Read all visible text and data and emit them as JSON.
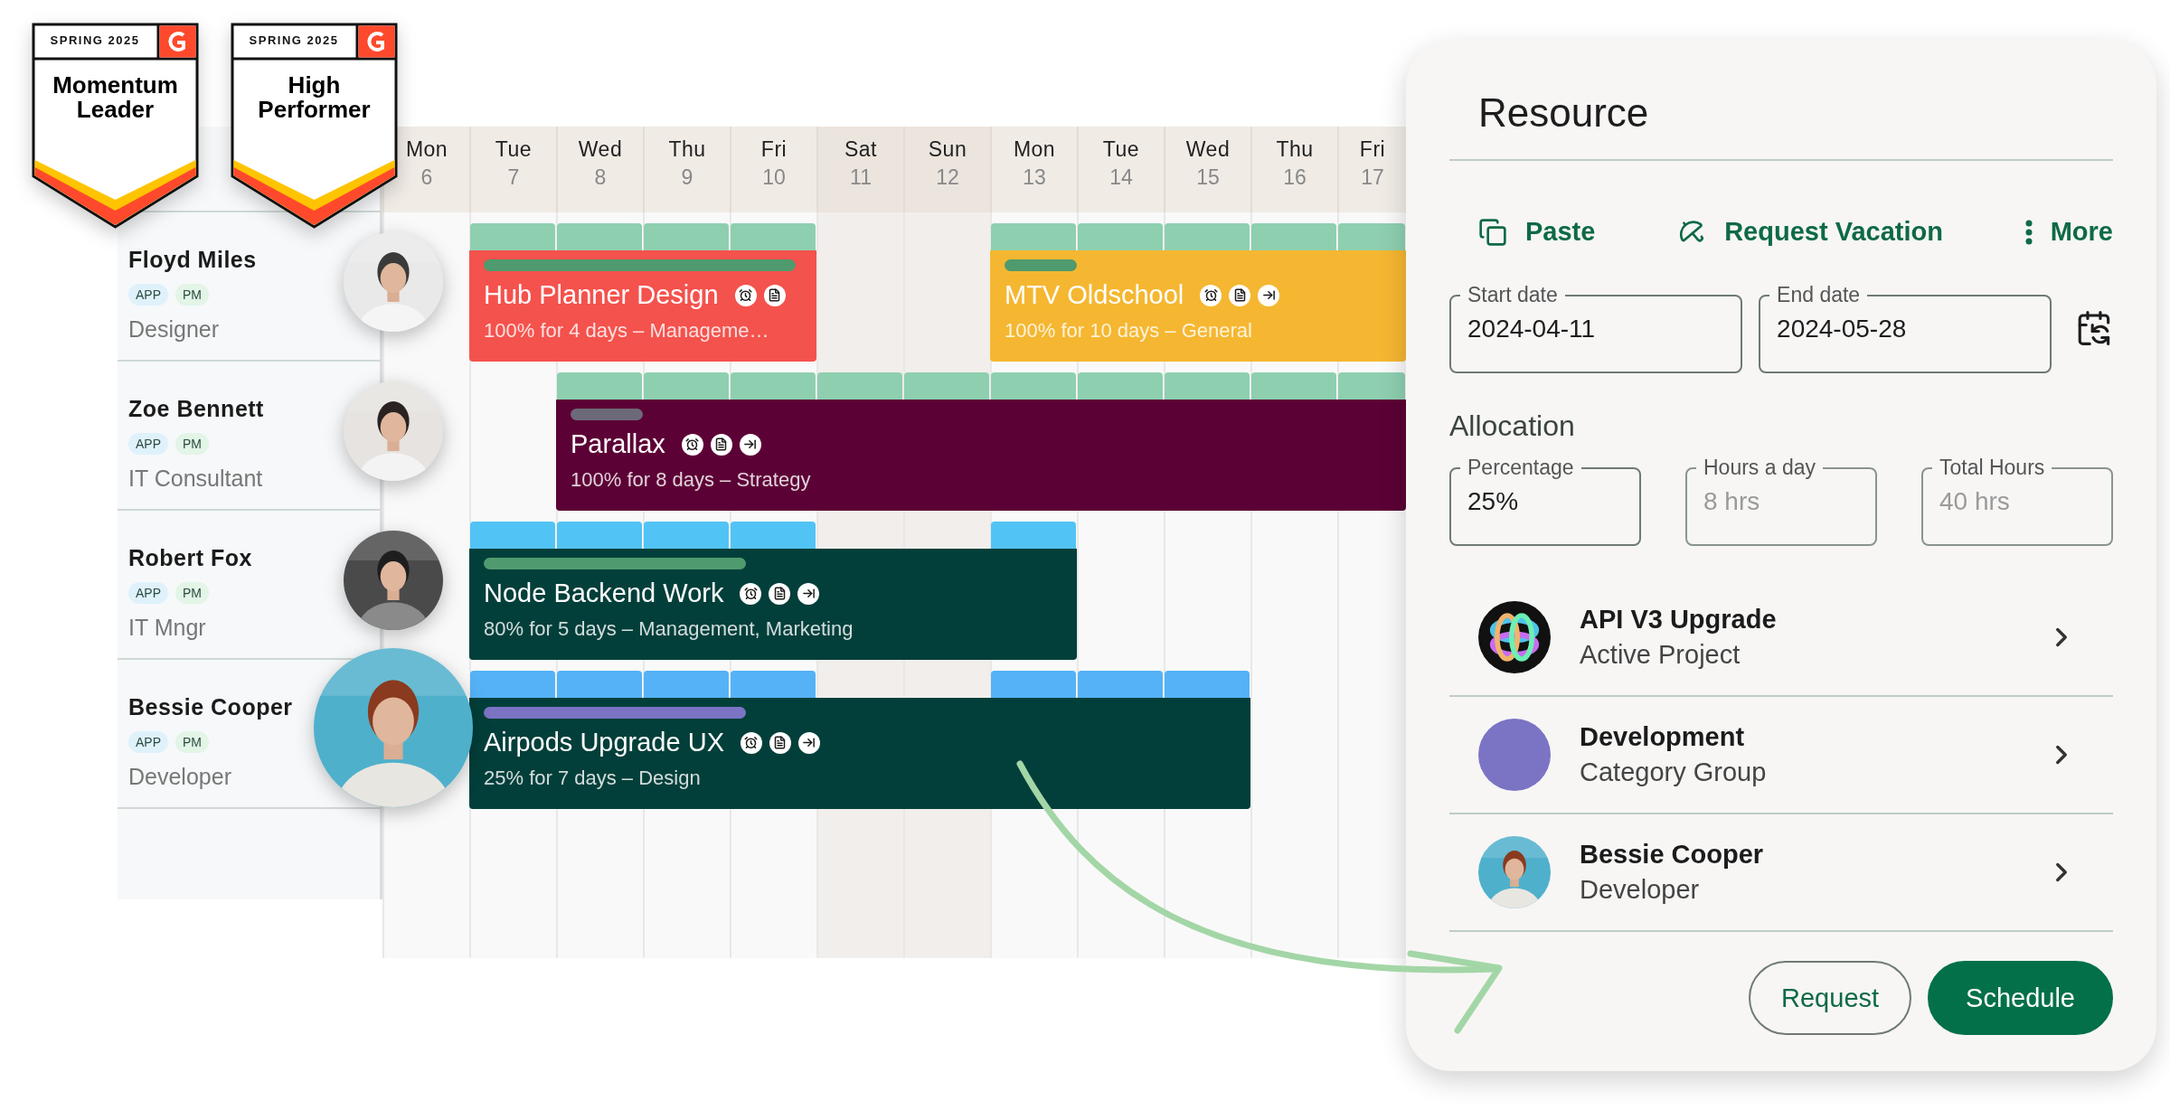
{
  "badges": [
    {
      "season": "SPRING 2025",
      "title": "Momentum Leader"
    },
    {
      "season": "SPRING 2025",
      "title": "High Performer"
    }
  ],
  "calendar": {
    "days": [
      {
        "weekday": "Mon",
        "date": "6",
        "weekend": false
      },
      {
        "weekday": "Tue",
        "date": "7",
        "weekend": false
      },
      {
        "weekday": "Wed",
        "date": "8",
        "weekend": false
      },
      {
        "weekday": "Thu",
        "date": "9",
        "weekend": false
      },
      {
        "weekday": "Fri",
        "date": "10",
        "weekend": false
      },
      {
        "weekday": "Sat",
        "date": "11",
        "weekend": true
      },
      {
        "weekday": "Sun",
        "date": "12",
        "weekend": true
      },
      {
        "weekday": "Mon",
        "date": "13",
        "weekend": false
      },
      {
        "weekday": "Tue",
        "date": "14",
        "weekend": false
      },
      {
        "weekday": "Wed",
        "date": "15",
        "weekend": false
      },
      {
        "weekday": "Thu",
        "date": "16",
        "weekend": false
      },
      {
        "weekday": "Fri",
        "date": "17",
        "weekend": false
      }
    ],
    "resources": [
      {
        "name": "Floyd Miles",
        "tags": [
          {
            "label": "APP",
            "color": "#dff2fb"
          },
          {
            "label": "PM",
            "color": "#e2f5e7"
          }
        ],
        "role": "Designer",
        "selected": false,
        "strip": {
          "color": "#8ecfb0"
        },
        "bookings": [
          {
            "title": "Hub Planner Design",
            "detail": "100% for 4 days – Manageme…",
            "color": "#f4524d",
            "bar": {
              "color": "#4f9a6e"
            },
            "icons": [
              {
                "kind": "alarm"
              },
              {
                "kind": "document"
              }
            ]
          },
          {
            "title": "MTV Oldschool",
            "detail": "100% for 10 days – General",
            "color": "#f5b731",
            "bar": {
              "color": "#4f9a6e"
            },
            "icons": [
              {
                "kind": "alarm"
              },
              {
                "kind": "document"
              },
              {
                "kind": "transfer"
              }
            ]
          }
        ]
      },
      {
        "name": "Zoe Bennett",
        "tags": [
          {
            "label": "APP",
            "color": "#dff2fb"
          },
          {
            "label": "PM",
            "color": "#e2f5e7"
          }
        ],
        "role": "IT Consultant",
        "selected": false,
        "strip": {
          "color": "#8ecfb0"
        },
        "bookings": [
          {
            "title": "Parallax",
            "detail": "100% for 8 days – Strategy",
            "color": "#5c0135",
            "bar": {
              "color": "#6c6a78"
            },
            "icons": [
              {
                "kind": "alarm"
              },
              {
                "kind": "document"
              },
              {
                "kind": "transfer"
              }
            ]
          }
        ]
      },
      {
        "name": "Robert Fox",
        "tags": [
          {
            "label": "APP",
            "color": "#dff2fb"
          },
          {
            "label": "PM",
            "color": "#e2f5e7"
          }
        ],
        "role": "IT Mngr",
        "selected": false,
        "strip": {
          "color": "#52c3f5"
        },
        "bookings": [
          {
            "title": "Node Backend Work",
            "detail": "80% for 5 days – Management, Marketing",
            "color": "#033f3a",
            "bar": {
              "color": "#4f9a6e"
            },
            "icons": [
              {
                "kind": "alarm"
              },
              {
                "kind": "document"
              },
              {
                "kind": "transfer"
              }
            ]
          }
        ]
      },
      {
        "name": "Bessie Cooper",
        "tags": [
          {
            "label": "APP",
            "color": "#dff2fb"
          },
          {
            "label": "PM",
            "color": "#e2f5e7"
          }
        ],
        "role": "Developer",
        "selected": true,
        "strip": {
          "color": "#55b2f7"
        },
        "bookings": [
          {
            "title": "Airpods Upgrade UX",
            "detail": "25% for 7 days – Design",
            "color": "#033f3a",
            "bar": {
              "color": "#7b74c4"
            },
            "icons": [
              {
                "kind": "alarm"
              },
              {
                "kind": "document"
              },
              {
                "kind": "transfer"
              }
            ]
          }
        ]
      }
    ]
  },
  "panel": {
    "title": "Resource",
    "actions": [
      {
        "label": "Paste",
        "kind": "paste"
      },
      {
        "label": "Request Vacation",
        "kind": "vacation"
      },
      {
        "label": "More",
        "kind": "more"
      }
    ],
    "dates": [
      {
        "label": "Start date",
        "value": "2024-04-11"
      },
      {
        "label": "End date",
        "value": "2024-05-28"
      }
    ],
    "allocation": {
      "title": "Allocation",
      "fields": [
        {
          "label": "Percentage",
          "value": "25%",
          "disabled": false
        },
        {
          "label": "Hours a day",
          "value": "8 hrs",
          "disabled": true
        },
        {
          "label": "Total Hours",
          "value": "40 hrs",
          "disabled": true
        }
      ]
    },
    "links": [
      {
        "title": "API V3 Upgrade",
        "subtitle": "Active Project",
        "kind": "picture"
      },
      {
        "title": "Development",
        "subtitle": "Category Group",
        "kind": "dot",
        "color": "#7b74c4"
      },
      {
        "title": "Bessie Cooper",
        "subtitle": "Developer",
        "kind": "picture"
      }
    ],
    "buttons": [
      {
        "label": "Request",
        "kind": "secondary"
      },
      {
        "label": "Schedule",
        "kind": "primary"
      }
    ]
  }
}
